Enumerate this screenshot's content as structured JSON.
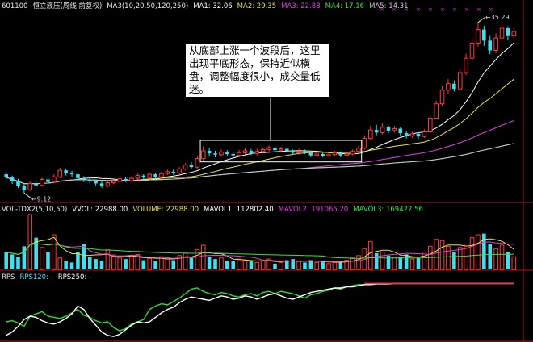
{
  "header": {
    "code": "601100",
    "name": "恒立液压(周线 前复权)",
    "ma_label": "MA3(10,20,50,120,250)",
    "ma1": "MA1: 32.06",
    "ma2": "MA2: 29.35",
    "ma3": "MA3: 22.88",
    "ma4": "MA4: 17.16",
    "ma5": "MA5: 14.31"
  },
  "vol_header": {
    "name": "VOL-TDX2(5,10,50)",
    "vvol": "VVOL: 22988.00",
    "volume": "VOLUME: 22988.00",
    "mavol1": "MAVOL1: 112802.40",
    "mavol2": "MAVOL2: 191065.20",
    "mavol3": "MAVOL3: 169422.56"
  },
  "rps_header": {
    "name": "RPS",
    "rps120": "RPS120: -",
    "rps250": "RPS250: -"
  },
  "annotation": "从底部上涨一个波段后，这里出现平底形态，保持近似横盘，调整幅度很小，成交量低迷。",
  "labels": {
    "high": "35.29",
    "low": "9.12"
  },
  "colors": {
    "up": "#ff3b3b",
    "down": "#3fe0f0",
    "ma1": "#ffffff",
    "ma2": "#e8e04a",
    "ma3": "#e040e0",
    "ma4": "#40e040",
    "ma5": "#c8c8c8",
    "axis": "#b01818"
  },
  "chart_data": {
    "type": "candlestick",
    "period": "weekly",
    "low_marker": 9.12,
    "high_marker": 35.29,
    "price_min": 7.8,
    "price_max": 37.0,
    "candles": [
      [
        12.0,
        11.5,
        12.4,
        11.1
      ],
      [
        11.5,
        11.0,
        11.8,
        10.5
      ],
      [
        11.0,
        10.2,
        11.3,
        9.9
      ],
      [
        10.2,
        9.6,
        10.5,
        9.12
      ],
      [
        9.6,
        10.6,
        10.9,
        9.4
      ],
      [
        10.6,
        10.3,
        11.1,
        10.0
      ],
      [
        10.3,
        11.2,
        11.5,
        10.1
      ],
      [
        11.2,
        10.8,
        11.6,
        10.5
      ],
      [
        10.8,
        11.6,
        12.0,
        10.6
      ],
      [
        11.6,
        12.6,
        13.0,
        11.4
      ],
      [
        12.6,
        12.2,
        12.9,
        11.8
      ],
      [
        12.2,
        12.0,
        12.5,
        11.6
      ],
      [
        12.0,
        11.4,
        12.3,
        11.1
      ],
      [
        11.4,
        11.2,
        11.7,
        10.8
      ],
      [
        11.2,
        10.9,
        11.5,
        10.6
      ],
      [
        10.9,
        10.6,
        11.2,
        10.3
      ],
      [
        10.6,
        10.2,
        10.9,
        9.9
      ],
      [
        10.2,
        10.7,
        11.0,
        10.0
      ],
      [
        10.7,
        10.9,
        11.2,
        10.5
      ],
      [
        10.9,
        11.3,
        11.6,
        10.7
      ],
      [
        11.3,
        11.0,
        11.6,
        10.8
      ],
      [
        11.0,
        11.4,
        11.7,
        10.8
      ],
      [
        11.4,
        11.8,
        12.1,
        11.2
      ],
      [
        11.8,
        11.5,
        12.0,
        11.2
      ],
      [
        11.5,
        12.0,
        12.3,
        11.3
      ],
      [
        12.0,
        11.6,
        12.2,
        11.3
      ],
      [
        11.6,
        12.1,
        12.4,
        11.4
      ],
      [
        12.1,
        12.4,
        12.7,
        11.9
      ],
      [
        12.4,
        12.2,
        12.8,
        11.9
      ],
      [
        12.2,
        12.8,
        13.1,
        12.0
      ],
      [
        12.8,
        13.4,
        13.7,
        12.6
      ],
      [
        13.4,
        13.1,
        13.9,
        12.8
      ],
      [
        13.1,
        14.4,
        14.8,
        12.9
      ],
      [
        14.4,
        15.6,
        16.3,
        14.1
      ],
      [
        15.6,
        15.2,
        16.1,
        14.7
      ],
      [
        15.2,
        15.0,
        15.6,
        14.6
      ],
      [
        15.0,
        15.4,
        15.8,
        14.7
      ],
      [
        15.4,
        15.1,
        15.7,
        14.8
      ],
      [
        15.1,
        14.9,
        15.4,
        14.5
      ],
      [
        14.9,
        15.3,
        15.7,
        14.6
      ],
      [
        15.3,
        15.6,
        16.0,
        15.0
      ],
      [
        15.6,
        15.2,
        15.9,
        14.9
      ],
      [
        15.2,
        15.5,
        15.9,
        14.9
      ],
      [
        15.5,
        15.8,
        16.1,
        15.2
      ],
      [
        15.8,
        16.1,
        16.4,
        15.5
      ],
      [
        16.1,
        15.7,
        16.3,
        15.4
      ],
      [
        15.7,
        15.9,
        16.2,
        15.4
      ],
      [
        15.9,
        15.6,
        16.1,
        15.3
      ],
      [
        15.6,
        15.3,
        15.8,
        15.0
      ],
      [
        15.3,
        15.5,
        15.9,
        15.0
      ],
      [
        15.5,
        15.3,
        15.8,
        15.1
      ],
      [
        15.3,
        14.9,
        15.4,
        14.6
      ],
      [
        14.9,
        15.1,
        15.4,
        14.7
      ],
      [
        15.1,
        14.8,
        15.3,
        14.6
      ],
      [
        14.8,
        15.0,
        15.3,
        14.6
      ],
      [
        15.0,
        15.3,
        15.6,
        14.8
      ],
      [
        15.3,
        14.9,
        15.5,
        14.6
      ],
      [
        14.9,
        15.1,
        15.4,
        14.7
      ],
      [
        15.1,
        15.5,
        15.8,
        14.9
      ],
      [
        15.5,
        16.0,
        16.4,
        15.3
      ],
      [
        16.0,
        17.5,
        18.0,
        15.8
      ],
      [
        17.5,
        18.8,
        19.4,
        17.2
      ],
      [
        18.8,
        18.4,
        19.6,
        18.0
      ],
      [
        18.4,
        19.2,
        19.8,
        18.1
      ],
      [
        19.2,
        18.7,
        19.5,
        18.3
      ],
      [
        18.7,
        19.0,
        19.4,
        18.4
      ],
      [
        19.0,
        18.3,
        19.2,
        17.9
      ],
      [
        18.3,
        17.9,
        18.6,
        17.5
      ],
      [
        17.9,
        18.2,
        18.5,
        17.6
      ],
      [
        18.2,
        17.8,
        18.4,
        17.4
      ],
      [
        17.8,
        18.5,
        18.9,
        17.6
      ],
      [
        18.5,
        20.6,
        21.0,
        18.3
      ],
      [
        20.6,
        22.8,
        23.3,
        20.4
      ],
      [
        22.8,
        24.9,
        25.5,
        22.5
      ],
      [
        24.9,
        25.9,
        26.6,
        24.3
      ],
      [
        25.9,
        25.1,
        26.4,
        24.7
      ],
      [
        25.1,
        27.6,
        28.2,
        24.9
      ],
      [
        27.6,
        29.8,
        30.5,
        27.2
      ],
      [
        29.8,
        32.1,
        33.0,
        29.4
      ],
      [
        32.1,
        34.2,
        35.29,
        31.6
      ],
      [
        34.2,
        32.5,
        34.8,
        31.7
      ],
      [
        32.5,
        31.0,
        33.2,
        30.4
      ],
      [
        31.0,
        32.9,
        33.6,
        30.6
      ],
      [
        32.9,
        34.4,
        35.0,
        32.4
      ],
      [
        34.4,
        33.2,
        34.7,
        32.6
      ],
      [
        33.2,
        33.9,
        34.5,
        32.8
      ]
    ],
    "volume": [
      30,
      26,
      22,
      40,
      95,
      55,
      38,
      30,
      60,
      20,
      14,
      12,
      30,
      44,
      22,
      18,
      14,
      34,
      25,
      20,
      18,
      22,
      26,
      16,
      19,
      14,
      22,
      20,
      16,
      24,
      28,
      20,
      34,
      42,
      22,
      18,
      20,
      15,
      14,
      18,
      16,
      14,
      12,
      15,
      18,
      10,
      12,
      16,
      18,
      14,
      12,
      16,
      12,
      14,
      10,
      12,
      14,
      16,
      20,
      24,
      36,
      48,
      28,
      30,
      24,
      20,
      22,
      26,
      18,
      20,
      30,
      40,
      52,
      50,
      40,
      30,
      38,
      44,
      55,
      60,
      62,
      44,
      36,
      42,
      30,
      22
    ],
    "rps120": [
      30,
      32,
      28,
      22,
      40,
      44,
      48,
      40,
      38,
      36,
      40,
      46,
      52,
      42,
      38,
      32,
      28,
      30,
      20,
      14,
      18,
      26,
      30,
      34,
      52,
      58,
      62,
      60,
      66,
      72,
      80,
      88,
      90,
      84,
      80,
      78,
      82,
      80,
      76,
      74,
      78,
      80,
      76,
      82,
      84,
      80,
      84,
      82,
      80,
      76,
      72,
      78,
      80,
      84,
      86,
      90,
      88,
      92,
      94,
      96,
      96,
      97,
      98,
      98,
      98,
      98,
      98,
      98,
      98,
      98,
      98,
      98,
      98,
      98,
      98,
      98,
      98,
      98,
      98,
      98,
      98,
      98,
      98,
      98,
      98,
      98
    ],
    "rps250": [
      6,
      12,
      22,
      34,
      40,
      38,
      32,
      28,
      26,
      30,
      36,
      44,
      58,
      52,
      36,
      24,
      12,
      6,
      4,
      8,
      16,
      24,
      30,
      28,
      30,
      38,
      46,
      52,
      56,
      64,
      70,
      74,
      72,
      70,
      68,
      72,
      76,
      74,
      70,
      72,
      76,
      74,
      70,
      74,
      78,
      80,
      76,
      72,
      70,
      74,
      78,
      82,
      84,
      86,
      88,
      90,
      90,
      92,
      92,
      94,
      96,
      96,
      97,
      97,
      97,
      98,
      98,
      98,
      98,
      98,
      98,
      98,
      98,
      98,
      98,
      98,
      98,
      98,
      98,
      98,
      98,
      98,
      98,
      98,
      98,
      98
    ]
  }
}
